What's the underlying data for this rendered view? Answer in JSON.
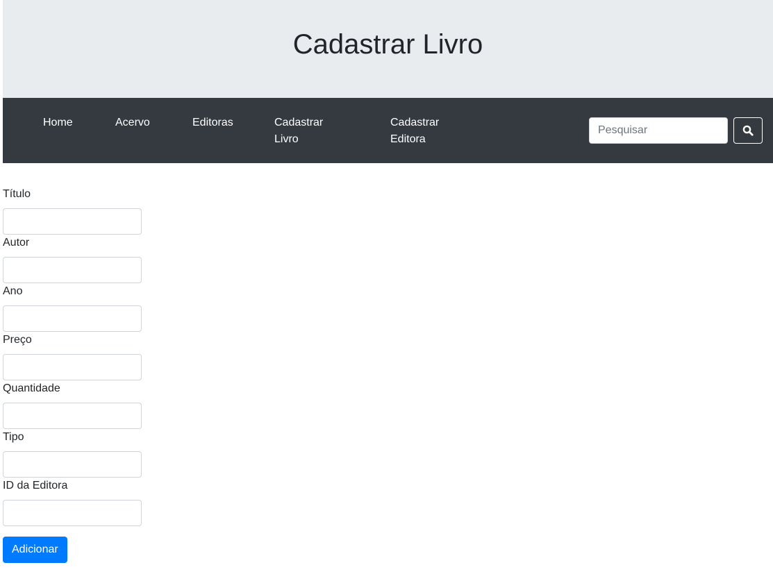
{
  "header": {
    "title": "Cadastrar Livro"
  },
  "nav": {
    "items": [
      {
        "label": "Home"
      },
      {
        "label": "Acervo"
      },
      {
        "label": "Editoras"
      },
      {
        "label_line1": "Cadastrar",
        "label_line2": "Livro"
      },
      {
        "label_line1": "Cadastrar",
        "label_line2": "Editora"
      }
    ],
    "search": {
      "placeholder": "Pesquisar",
      "value": "",
      "icon": "search-icon"
    }
  },
  "form": {
    "fields": [
      {
        "label": "Título",
        "value": ""
      },
      {
        "label": "Autor",
        "value": ""
      },
      {
        "label": "Ano",
        "value": ""
      },
      {
        "label": "Preço",
        "value": ""
      },
      {
        "label": "Quantidade",
        "value": ""
      },
      {
        "label": "Tipo",
        "value": ""
      },
      {
        "label": "ID da Editora",
        "value": ""
      }
    ],
    "submit_label": "Adicionar"
  },
  "colors": {
    "header_bg": "#e9ecef",
    "navbar_bg": "#343a40",
    "primary": "#007bff"
  }
}
